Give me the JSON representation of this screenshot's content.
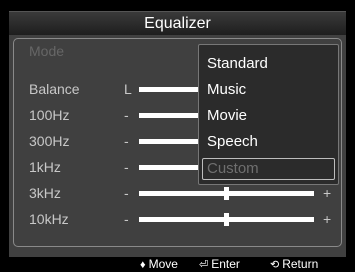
{
  "window": {
    "title": "Equalizer"
  },
  "rows": {
    "mode": {
      "label": "Mode",
      "separator": ":"
    },
    "balance": {
      "label": "Balance",
      "left_sign": "L",
      "level": 0.5
    },
    "band_100": {
      "label": "100Hz",
      "minus": "-",
      "level": 0.5
    },
    "band_300": {
      "label": "300Hz",
      "minus": "-",
      "level": 0.5
    },
    "band_1k": {
      "label": "1kHz",
      "minus": "-",
      "level": 0.5
    },
    "band_3k": {
      "label": "3kHz",
      "minus": "-",
      "plus": "+",
      "level": 0.5
    },
    "band_10k": {
      "label": "10kHz",
      "minus": "-",
      "plus": "+",
      "level": 0.5
    }
  },
  "mode_dropdown": {
    "options": [
      "Standard",
      "Music",
      "Movie",
      "Speech",
      "Custom"
    ],
    "disabled_option": "Custom"
  },
  "footer": {
    "move": {
      "icon": "updown-icon",
      "label": "Move"
    },
    "enter": {
      "icon": "enter-icon",
      "label": "Enter"
    },
    "return": {
      "icon": "return-icon",
      "label": "Return"
    }
  },
  "colors": {
    "panel": "#404040",
    "background": "#000000",
    "text": "#ffffff",
    "dim_text": "#666666"
  }
}
